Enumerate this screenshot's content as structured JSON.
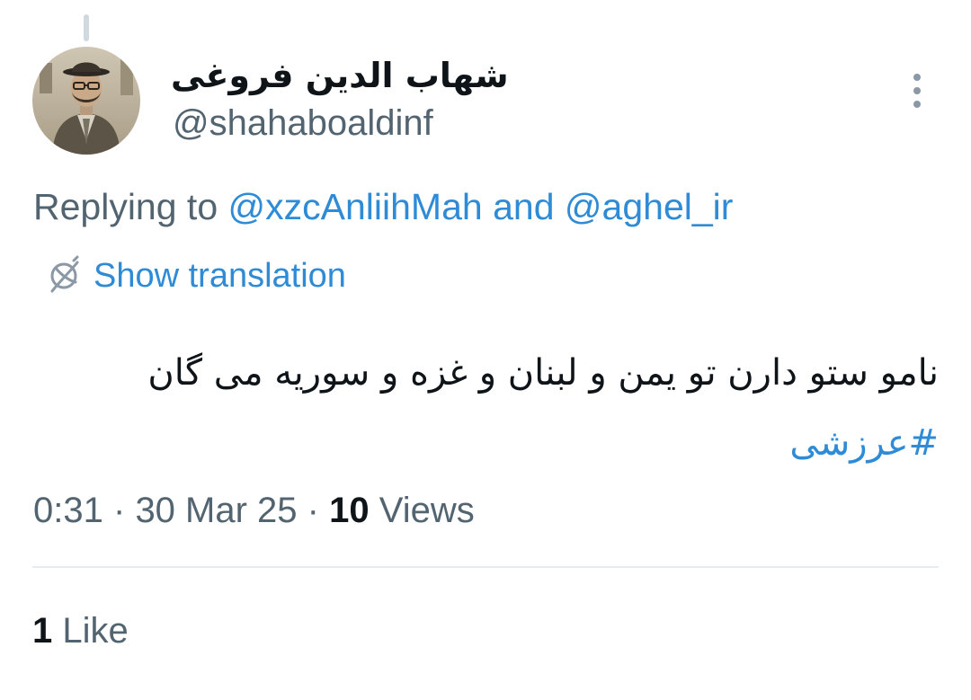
{
  "author": {
    "display_name": "شهاب الدین فروغی",
    "handle": "@shahaboaldinf",
    "avatar": "profile-photo"
  },
  "menu": {
    "icon": "more-vertical-icon"
  },
  "reply": {
    "prefix": "Replying to",
    "mention_1": "@xzcAnliihMah",
    "conjunction": "and",
    "mention_2": "@aghel_ir"
  },
  "translation": {
    "icon": "translate-globe-icon",
    "label": "Show translation"
  },
  "tweet": {
    "text": "نامو ستو دارن تو یمن و لبنان و غزه و سوریه می گان",
    "hashtag": "#عرزشی"
  },
  "meta": {
    "time": "0:31",
    "separator": "·",
    "date": "30 Mar 25",
    "views_count": "10",
    "views_label": "Views"
  },
  "engagement": {
    "likes_count": "1",
    "likes_label": "Like"
  },
  "colors": {
    "link": "#2f8bd6",
    "secondary_text": "#536471",
    "primary_text": "#0f1419",
    "divider": "#e7ecf0",
    "thread_line": "#cfd9de"
  }
}
